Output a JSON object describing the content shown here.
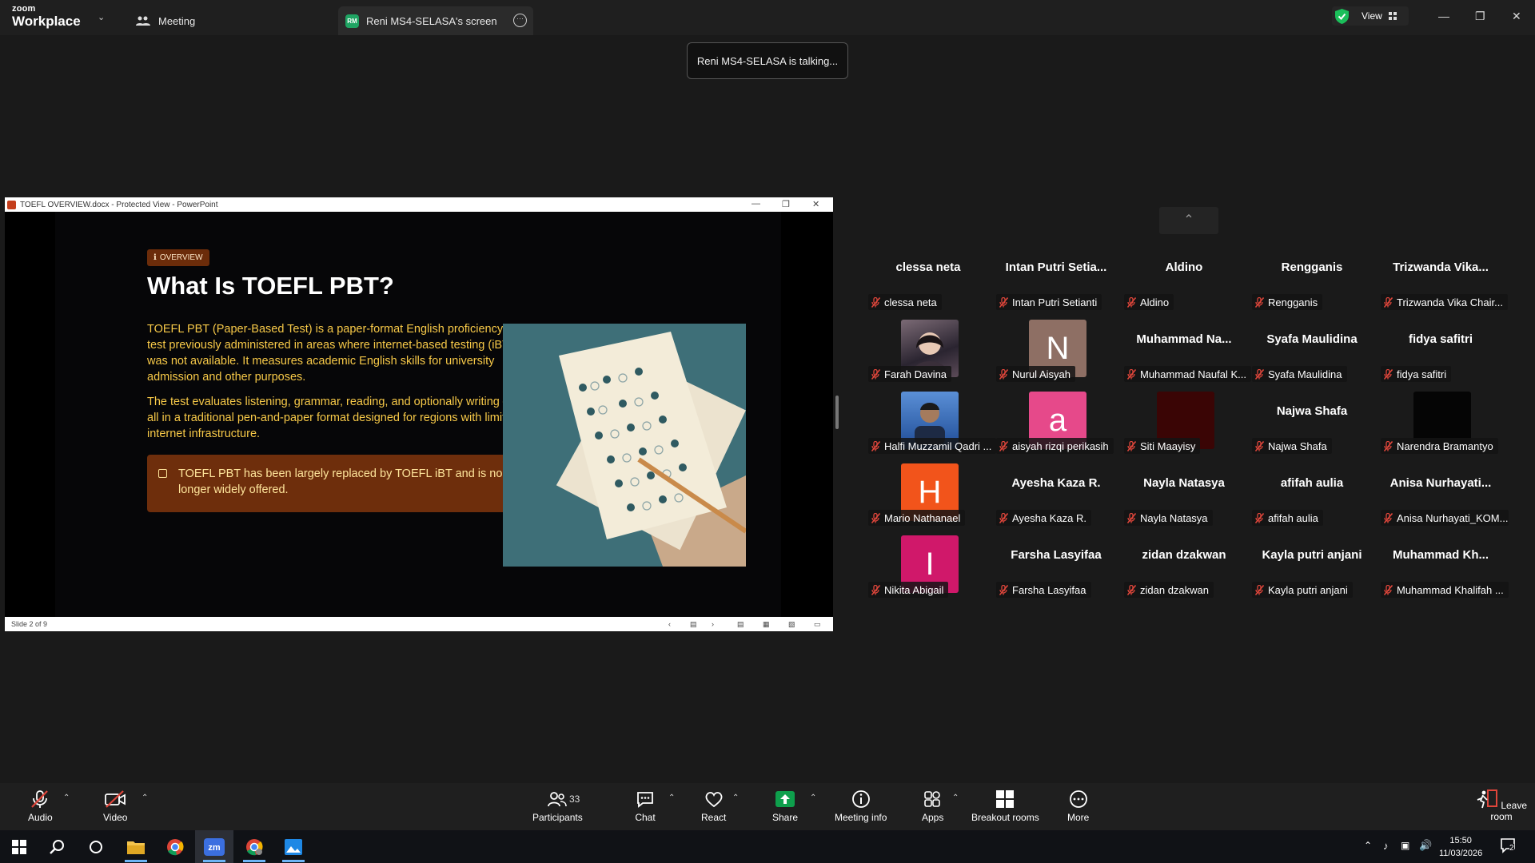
{
  "app": {
    "brand_small": "zoom",
    "brand_large": "Workplace"
  },
  "tabs": {
    "meeting": "Meeting",
    "screen_initials": "RM",
    "screen": "Reni MS4-SELASA's screen"
  },
  "header": {
    "view_label": "View"
  },
  "notification": "Reni MS4-SELASA is talking...",
  "powerpoint": {
    "title": "TOEFL OVERVIEW.docx - Protected View - PowerPoint",
    "status": "Slide 2 of 9",
    "slide": {
      "badge": "OVERVIEW",
      "heading": "What Is TOEFL PBT?",
      "para1": "TOEFL PBT (Paper-Based Test) is a paper-format English proficiency test previously administered in areas where internet-based testing (iBT) was not available. It measures academic English skills for university admission and other purposes.",
      "para2": "The test evaluates listening, grammar, reading, and optionally writing — all in a traditional pen-and-paper format designed for regions with limited internet infrastructure.",
      "note": "TOEFL PBT has been largely replaced by TOEFL iBT and is no longer widely offered."
    }
  },
  "participants": [
    {
      "name": "clessa neta",
      "label": "clessa neta"
    },
    {
      "name": "Intan Putri Setia...",
      "label": "Intan Putri Setianti"
    },
    {
      "name": "Aldino",
      "label": "Aldino"
    },
    {
      "name": "Rengganis",
      "label": "Rengganis"
    },
    {
      "name": "Trizwanda Vika...",
      "label": "Trizwanda Vika Chair..."
    },
    {
      "avatar": "photo",
      "label": "Farah Davina"
    },
    {
      "avatar": "letter",
      "letter": "N",
      "color": "#8e6f64",
      "label": "Nurul Aisyah"
    },
    {
      "name": "Muhammad Na...",
      "label": "Muhammad Naufal K..."
    },
    {
      "name": "Syafa Maulidina",
      "label": "Syafa Maulidina"
    },
    {
      "name": "fidya safitri",
      "label": "fidya safitri"
    },
    {
      "avatar": "photo2",
      "label": "Halfi Muzzamil Qadri ..."
    },
    {
      "avatar": "letter",
      "letter": "a",
      "color": "#e6498a",
      "label": "aisyah rizqi perikasih"
    },
    {
      "avatar": "video",
      "color": "#3a0505",
      "label": "Siti Maayisy"
    },
    {
      "name": "Najwa Shafa",
      "label": "Najwa Shafa"
    },
    {
      "avatar": "video",
      "color": "#050505",
      "label": "Narendra Bramantyo"
    },
    {
      "avatar": "letter",
      "letter": "H",
      "color": "#f2541b",
      "label": "Mario Nathanael"
    },
    {
      "name": "Ayesha Kaza R.",
      "label": "Ayesha Kaza R."
    },
    {
      "name": "Nayla Natasya",
      "label": "Nayla Natasya"
    },
    {
      "name": "afifah aulia",
      "label": "afifah aulia"
    },
    {
      "name": "Anisa Nurhayati...",
      "label": "Anisa Nurhayati_KOM..."
    },
    {
      "avatar": "letter",
      "letter": "I",
      "color": "#d0186a",
      "label": "Nikita Abigail"
    },
    {
      "name": "Farsha Lasyifaa",
      "label": "Farsha Lasyifaa"
    },
    {
      "name": "zidan dzakwan",
      "label": "zidan dzakwan"
    },
    {
      "name": "Kayla putri anjani",
      "label": "Kayla putri anjani"
    },
    {
      "name": "Muhammad Kh...",
      "label": "Muhammad Khalifah ..."
    }
  ],
  "toolbar": {
    "audio": "Audio",
    "video": "Video",
    "participants": "Participants",
    "participants_count": "33",
    "chat": "Chat",
    "react": "React",
    "share": "Share",
    "meeting_info": "Meeting info",
    "apps": "Apps",
    "breakout": "Breakout rooms",
    "more": "More",
    "leave": "Leave room"
  },
  "taskbar": {
    "time": "15:50",
    "date": "11/03/2026",
    "notif_count": "2"
  },
  "colors": {
    "share_green": "#0e9f4c",
    "muted_red": "#e0463b",
    "accent_blue": "#6cb4f5"
  }
}
